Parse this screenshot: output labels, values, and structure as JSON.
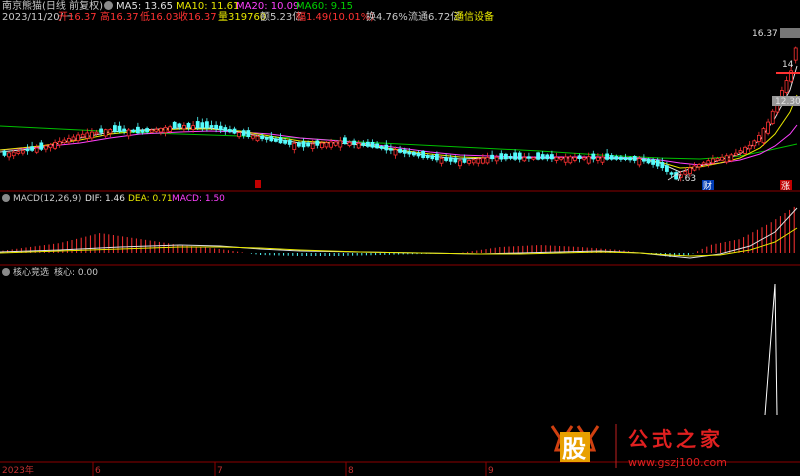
{
  "header": {
    "stock": "南京熊猫(日线 前复权)",
    "ma5": "MA5: 13.65",
    "ma10": "MA10: 11.61",
    "ma20": "MA20: 10.09",
    "ma60": "MA60: 9.15",
    "date": "2023/11/20/一",
    "open": "开16.37",
    "high": "高16.37",
    "low": "低16.03",
    "close": "收16.37",
    "volume": "量319760",
    "amount": "额5.23亿",
    "change": "幅1.49(10.01%)",
    "turnover": "换4.76%",
    "float": "流通6.72亿",
    "industry": "通信设备"
  },
  "price_axis": {
    "l1": "16.37",
    "l2": "14",
    "l3": "12.30"
  },
  "price_labels": {
    "low_mark": "7.63",
    "cai": "财",
    "zhang": "涨"
  },
  "macd_header": {
    "name": "MACD(12,26,9)",
    "dif": "DIF: 1.46",
    "dea": "DEA: 0.71",
    "macd": "MACD: 1.50"
  },
  "core_header": {
    "name": "核心竞选",
    "value": "核心: 0.00"
  },
  "x_axis": [
    "2023年",
    "6",
    "7",
    "8",
    "9"
  ],
  "watermark": {
    "logo": "股",
    "text": "公式之家",
    "url": "www.gszj100.com"
  },
  "colors": {
    "up": "#ff3232",
    "down": "#54fcfc",
    "ma5": "#e0e0e0",
    "ma10": "#e8e800",
    "ma20": "#ff40ff",
    "ma60": "#00c000",
    "macd_up": "#ff3232",
    "macd_down": "#54fcfc"
  },
  "chart_data": {
    "type": "line",
    "title": "南京熊猫(日线 前复权)",
    "price_scale_ticks": [
      16.37,
      14,
      12.3
    ],
    "range_low": 7.63,
    "range_high": 16.37,
    "series": [
      {
        "name": "MA5",
        "last": 13.65
      },
      {
        "name": "MA10",
        "last": 11.61
      },
      {
        "name": "MA20",
        "last": 10.09
      },
      {
        "name": "MA60",
        "last": 9.15
      }
    ],
    "macd": {
      "DIF": 1.46,
      "DEA": 0.71,
      "MACD": 1.5
    },
    "core": 0.0,
    "x_labels": [
      "2023年",
      "6",
      "7",
      "8",
      "9"
    ]
  }
}
